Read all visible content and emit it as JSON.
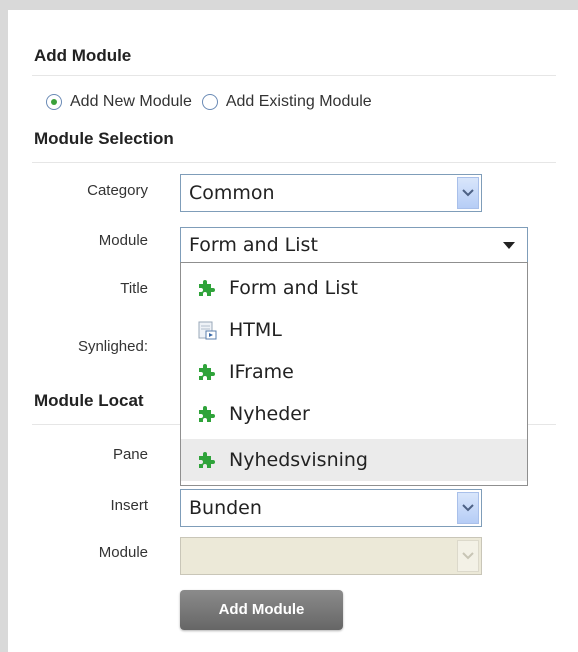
{
  "add_module": {
    "title": "Add Module",
    "radio_new_label": "Add New Module",
    "radio_existing_label": "Add Existing Module",
    "selected_option": "Add New Module"
  },
  "module_selection": {
    "title": "Module Selection",
    "category_label": "Category",
    "category_value": "Common",
    "module_label": "Module",
    "module_value": "Form and List",
    "title_label": "Title",
    "visibility_label": "Synlighed:"
  },
  "module_dropdown": {
    "items": [
      {
        "label": "Form and List",
        "icon": "puzzle-icon"
      },
      {
        "label": "HTML",
        "icon": "html-document-icon"
      },
      {
        "label": "IFrame",
        "icon": "puzzle-icon"
      },
      {
        "label": "Nyheder",
        "icon": "puzzle-icon"
      },
      {
        "label": "Nyhedsvisning",
        "icon": "puzzle-icon"
      }
    ],
    "highlighted": "Nyhedsvisning"
  },
  "module_location": {
    "title": "Module Locat",
    "pane_label": "Pane",
    "insert_label": "Insert",
    "insert_value": "Bunden",
    "module_label": "Module",
    "module_value": ""
  },
  "actions": {
    "add_button_label": "Add Module"
  },
  "colors": {
    "puzzle_icon": "#2fa33a",
    "button_bg": "#777777",
    "select_border": "#7f9db9"
  }
}
